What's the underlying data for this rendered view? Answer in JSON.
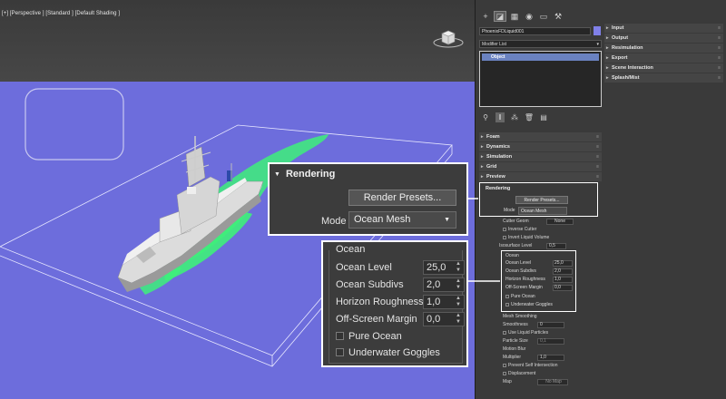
{
  "viewport": {
    "label": "[+] [Perspective ] [Standard ] [Default Shading ]"
  },
  "command_panel": {
    "tabs": [
      "create-icon",
      "modify-icon",
      "hierarchy-icon",
      "motion-icon",
      "display-icon",
      "utilities-icon"
    ],
    "object_name": "PhoenixFDLiquid001",
    "object_color": "#8080e8",
    "modifier_list": "Modifier List",
    "stack_item": "Object",
    "right_rollouts": [
      "Input",
      "Output",
      "Resimulation",
      "Export",
      "Scene Interaction",
      "Splash/Mist"
    ],
    "left_rollouts": [
      "Foam",
      "Dynamics",
      "Simulation",
      "Grid",
      "Preview"
    ]
  },
  "rendering_small": {
    "title": "Rendering",
    "presets_button": "Render Presets...",
    "mode_label": "Mode",
    "mode_value": "Ocean Mesh"
  },
  "mid_params": {
    "cutter_geom_label": "Cutter Geom",
    "cutter_geom_value": "None",
    "inverse_cutter": "Inverse Cutter",
    "invert_liquid_volume": "Invert Liquid Volume",
    "isosurface_label": "Isosurface Level",
    "isosurface_value": "0,5"
  },
  "ocean_small": {
    "title": "Ocean",
    "rows": [
      {
        "label": "Ocean Level",
        "value": "25,0"
      },
      {
        "label": "Ocean Subdivs",
        "value": "2,0"
      },
      {
        "label": "Horizon Roughness",
        "value": "1,0"
      },
      {
        "label": "Off-Screen Margin",
        "value": "0,0"
      }
    ],
    "pure_ocean": "Pure Ocean",
    "underwater_goggles": "Underwater Goggles"
  },
  "bottom_params": {
    "mesh_smoothing": "Mesh Smoothing",
    "smoothness_label": "Smoothness",
    "smoothness_value": "0",
    "use_liquid_particles": "Use Liquid Particles",
    "particle_size_label": "Particle Size",
    "particle_size_value": "0,1",
    "motion_blur": "Motion Blur",
    "multiplier_label": "Multiplier",
    "multiplier_value": "1,0",
    "prevent_self_intersection": "Prevent Self Intersection",
    "displacement": "Displacement",
    "map_label": "Map",
    "map_value": "No Map"
  },
  "zoom_rendering": {
    "title": "Rendering",
    "presets_button": "Render Presets...",
    "mode_label": "Mode",
    "mode_value": "Ocean Mesh"
  },
  "zoom_ocean": {
    "title": "Ocean",
    "rows": [
      {
        "label": "Ocean Level",
        "value": "25,0"
      },
      {
        "label": "Ocean Subdivs",
        "value": "2,0"
      },
      {
        "label": "Horizon Roughness",
        "value": "1,0"
      },
      {
        "label": "Off-Screen Margin",
        "value": "0,0"
      }
    ],
    "pure_ocean": "Pure Ocean",
    "underwater_goggles": "Underwater Goggles"
  }
}
